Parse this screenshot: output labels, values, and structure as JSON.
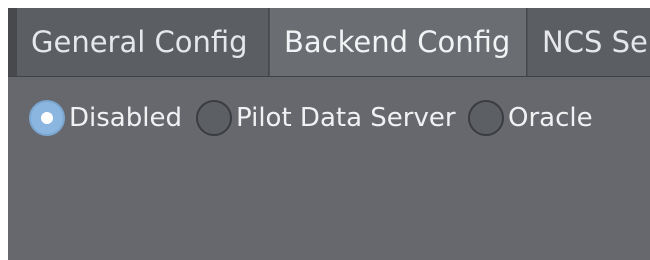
{
  "tabs": [
    {
      "label": "General Config",
      "selected": false
    },
    {
      "label": "Backend Config",
      "selected": true
    },
    {
      "label": "NCS Se",
      "selected": false
    }
  ],
  "backend": {
    "options": [
      {
        "label": "Disabled",
        "checked": true
      },
      {
        "label": "Pilot Data Server",
        "checked": false
      },
      {
        "label": "Oracle",
        "checked": false
      }
    ]
  },
  "colors": {
    "panel_bg": "#66686d",
    "tabbar_bg": "#4f5257",
    "radio_checked": "#8ab6df",
    "text": "#f0f1f3"
  }
}
